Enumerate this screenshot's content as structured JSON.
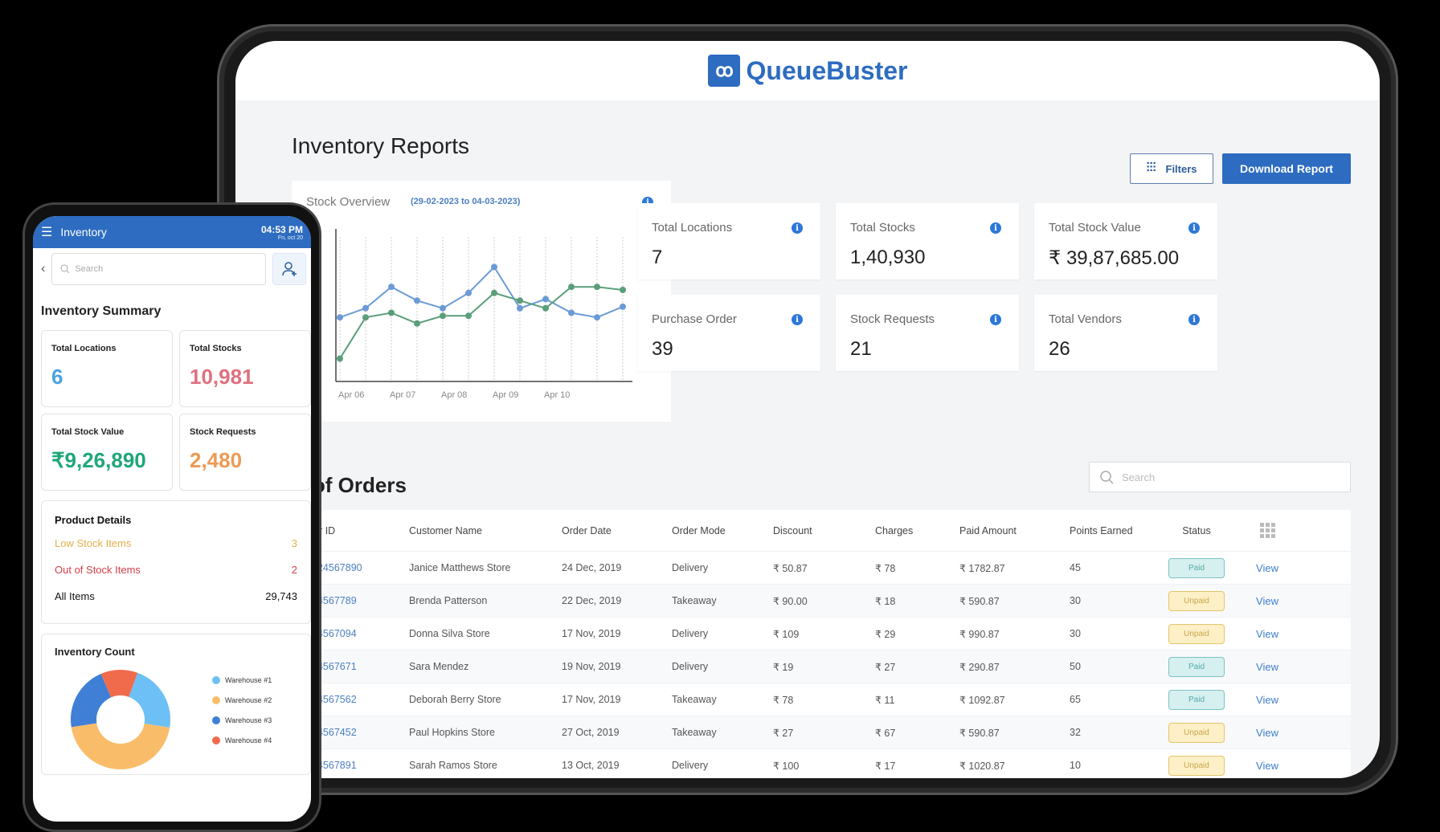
{
  "tablet": {
    "brand": {
      "logo_glyph": "QB",
      "name": "QueueBuster",
      "color": "#2d6cc0"
    },
    "page_title": "Inventory Reports",
    "filters_label": "Filters",
    "download_label": "Download Report",
    "stats": [
      {
        "label": "Total Locations",
        "value": "7"
      },
      {
        "label": "Total Stocks",
        "value": "1,40,930"
      },
      {
        "label": "Total Stock Value",
        "value": "₹ 39,87,685.00"
      },
      {
        "label": "Purchase Order",
        "value": "39"
      },
      {
        "label": "Stock Requests",
        "value": "21"
      },
      {
        "label": "Total Vendors",
        "value": "26"
      }
    ],
    "orders_title": "t of Orders",
    "search_placeholder": "Search",
    "columns": [
      "rder ID",
      "Customer Name",
      "Order Date",
      "Order Mode",
      "Discount",
      "Charges",
      "Paid Amount",
      "Points Earned",
      "Status"
    ],
    "rows": [
      {
        "id": "R124567890",
        "customer": "Janice Matthews Store",
        "date": "24 Dec, 2019",
        "mode": "Delivery",
        "discount": "₹ 50.87",
        "charges": "₹ 78",
        "paid": "₹ 1782.87",
        "points": "45",
        "status": "Paid",
        "action": "View"
      },
      {
        "id": "R34567789",
        "customer": "Brenda Patterson",
        "date": "22 Dec, 2019",
        "mode": "Takeaway",
        "discount": "₹ 90.00",
        "charges": "₹ 18",
        "paid": "₹ 590.87",
        "points": "30",
        "status": "Unpaid",
        "action": "View"
      },
      {
        "id": "R24567094",
        "customer": "Donna Silva Store",
        "date": "17 Nov, 2019",
        "mode": "Delivery",
        "discount": "₹ 109",
        "charges": "₹ 29",
        "paid": "₹ 990.87",
        "points": "30",
        "status": "Unpaid",
        "action": "View"
      },
      {
        "id": "R34567671",
        "customer": "Sara Mendez",
        "date": "19 Nov, 2019",
        "mode": "Delivery",
        "discount": "₹ 19",
        "charges": "₹ 27",
        "paid": "₹ 290.87",
        "points": "50",
        "status": "Paid",
        "action": "View"
      },
      {
        "id": "R34567562",
        "customer": "Deborah Berry Store",
        "date": "17 Nov, 2019",
        "mode": "Takeaway",
        "discount": "₹ 78",
        "charges": "₹ 11",
        "paid": "₹ 1092.87",
        "points": "65",
        "status": "Paid",
        "action": "View"
      },
      {
        "id": "R34567452",
        "customer": "Paul Hopkins Store",
        "date": "27 Oct, 2019",
        "mode": "Takeaway",
        "discount": "₹ 27",
        "charges": "₹ 67",
        "paid": "₹ 590.87",
        "points": "32",
        "status": "Unpaid",
        "action": "View"
      },
      {
        "id": "R34567891",
        "customer": "Sarah Ramos Store",
        "date": "13 Oct, 2019",
        "mode": "Delivery",
        "discount": "₹ 100",
        "charges": "₹ 17",
        "paid": "₹ 1020.87",
        "points": "10",
        "status": "Unpaid",
        "action": "View"
      }
    ]
  },
  "chart_data": [
    {
      "type": "line",
      "title": "Stock Overview",
      "subtitle": "(29-02-2023 to 04-03-2023)",
      "x_ticks": [
        "Apr 06",
        "Apr 07",
        "Apr 08",
        "Apr 09",
        "Apr 10"
      ],
      "grid": "vertical dotted",
      "ylim": [
        0,
        100
      ],
      "series": [
        {
          "name": "series-blue",
          "color": "#6b9bd6",
          "values": [
            42,
            48,
            62,
            53,
            48,
            58,
            75,
            48,
            54,
            45,
            42,
            49
          ]
        },
        {
          "name": "series-green",
          "color": "#5a9e7a",
          "values": [
            15,
            42,
            45,
            38,
            43,
            43,
            58,
            53,
            48,
            62,
            62,
            60
          ]
        }
      ]
    },
    {
      "type": "pie",
      "title": "Inventory Count",
      "donut": true,
      "labels": [
        "Warehouse #1",
        "Warehouse #2",
        "Warehouse #3",
        "Warehouse #4"
      ],
      "values": [
        22,
        45,
        21,
        12
      ],
      "colors": [
        "#6cc0f5",
        "#f9bd6a",
        "#3f7fd6",
        "#f06b4c"
      ]
    }
  ],
  "phone": {
    "header_title": "Inventory",
    "time": "04:53 PM",
    "date": "Fri, oct 20",
    "search_placeholder": "Search",
    "summary_title": "Inventory Summary",
    "cards": [
      {
        "label": "Total Locations",
        "value": "6",
        "color": "#4aa3df"
      },
      {
        "label": "Total Stocks",
        "value": "10,981",
        "color": "#e0707e"
      },
      {
        "label": "Total Stock Value",
        "value": "₹9,26,890",
        "color": "#1fa67a"
      },
      {
        "label": "Stock Requests",
        "value": "2,480",
        "color": "#ee9a55"
      }
    ],
    "product_details": {
      "title": "Product Details",
      "rows": [
        {
          "label": "Low Stock Items",
          "value": "3",
          "color": "#e0b04a"
        },
        {
          "label": "Out of Stock Items",
          "value": "2",
          "color": "#d0404a"
        },
        {
          "label": "All Items",
          "value": "29,743",
          "color": "#111"
        }
      ]
    }
  }
}
